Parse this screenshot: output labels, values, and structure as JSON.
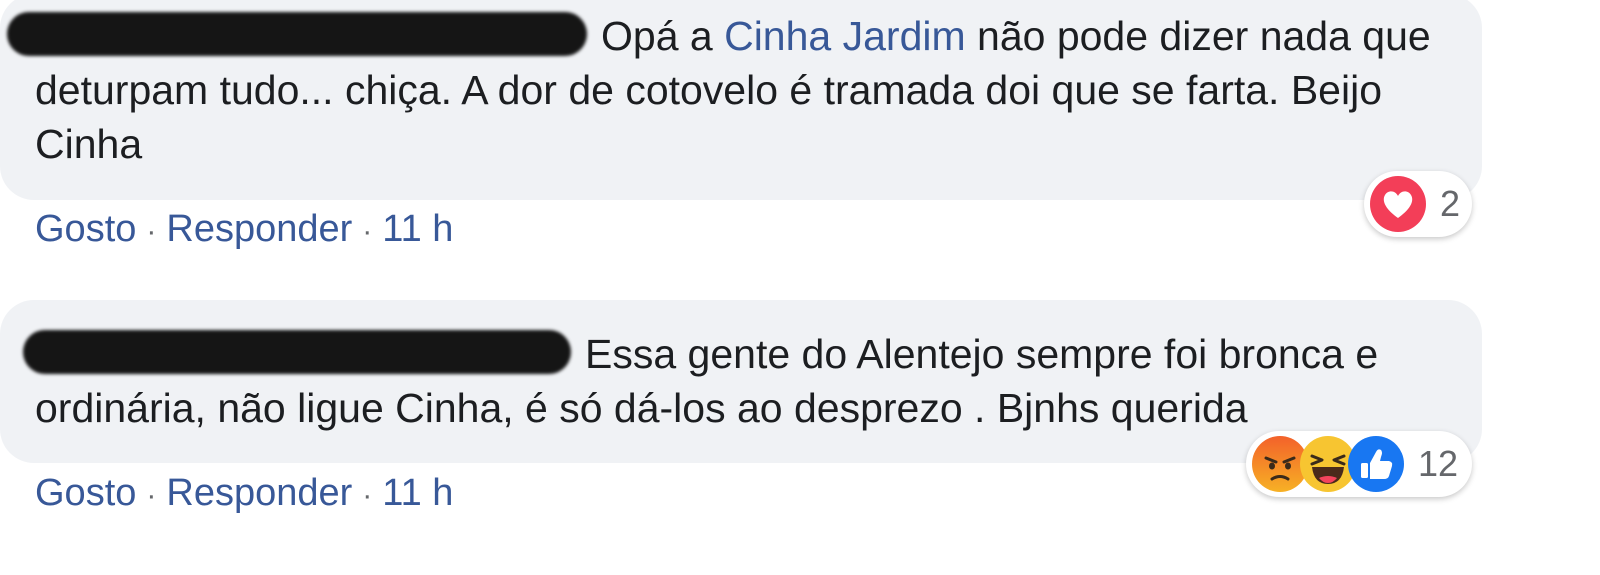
{
  "comments": [
    {
      "author": "████████████████",
      "text_before_mention": "Opá a ",
      "mention": "Cinha Jardim",
      "text_after_mention": " não pode dizer nada que deturpam tudo... chiça. A dor de cotovelo é tramada doi que se farta. Beijo Cinha",
      "actions": {
        "like": "Gosto",
        "separator": "·",
        "reply": "Responder",
        "time": "11 h"
      },
      "reactions": {
        "icons": [
          "love-icon"
        ],
        "count": "2"
      }
    },
    {
      "author": "████████████████",
      "text": "Essa gente do Alentejo sempre foi bronca e ordinária, não ligue Cinha, é só dá-los ao desprezo . Bjnhs querida",
      "actions": {
        "like": "Gosto",
        "separator": "·",
        "reply": "Responder",
        "time": "11 h"
      },
      "reactions": {
        "icons": [
          "angry-icon",
          "haha-icon",
          "like-icon"
        ],
        "count": "12"
      }
    }
  ],
  "colors": {
    "bubble": "#f0f2f5",
    "text": "#1c1e21",
    "link": "#385898",
    "love": "#f33e58",
    "like": "#1877f2"
  }
}
